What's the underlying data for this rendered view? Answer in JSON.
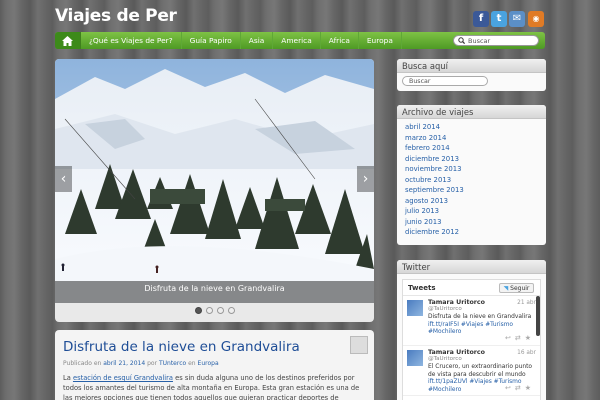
{
  "site": {
    "title": "Viajes de Per"
  },
  "social": {
    "icons": [
      "facebook-icon",
      "twitter-icon",
      "email-icon",
      "rss-icon"
    ],
    "colors": [
      "#3b5998",
      "#4aa3df",
      "#5b8fc7",
      "#e07b26"
    ]
  },
  "nav": {
    "items": [
      "¿Qué es Viajes de Per?",
      "Guía Papiro",
      "Asia",
      "America",
      "Africa",
      "Europa"
    ],
    "search_placeholder": "Buscar",
    "accent": "#5aa32e"
  },
  "slider": {
    "caption": "Disfruta de la nieve en Grandvalira",
    "slide_count": 4,
    "active_index": 0
  },
  "post": {
    "title": "Disfruta de la nieve en Grandvalira",
    "meta_prefix": "Publicado en",
    "date": "abril 21, 2014",
    "by": "por",
    "author": "TUnterco",
    "in": "en",
    "category": "Europa",
    "body_start": "La",
    "body_link": "estación de esquí Grandvalira",
    "body_rest": "es sin duda alguna uno de los destinos preferidos por todos los amantes del turismo de alta montaña en Europa. Esta gran estación es una de las mejores opciones que tienen todos aquellos que quieran practicar deportes de invierno en el"
  },
  "sidebar": {
    "search_title": "Busca aquí",
    "search_placeholder": "Buscar",
    "archive_title": "Archivo de viajes",
    "archive": [
      "abril 2014",
      "marzo 2014",
      "febrero 2014",
      "diciembre 2013",
      "noviembre 2013",
      "octubre 2013",
      "septiembre 2013",
      "agosto 2013",
      "julio 2013",
      "junio 2013",
      "diciembre 2012"
    ],
    "twitter_title": "Twitter"
  },
  "twitter": {
    "header": "Tweets",
    "follow": "Seguir",
    "tweets": [
      {
        "name": "Tamara Uritorco",
        "handle": "@TaUritorco",
        "date": "21 abr",
        "text": "Disfruta de la nieve en Grandvalira",
        "tags": "ift.tt/raIF5I #Viajes #Turismo #Mochilero"
      },
      {
        "name": "Tamara Uritorco",
        "handle": "@TaUritorco",
        "date": "16 abr",
        "text": "El Crucero, un extraordinario punto de vista para descubrir el mundo",
        "tags": "ift.tt/1paZUVl #Viajes #Turismo #Mochilero"
      }
    ]
  }
}
